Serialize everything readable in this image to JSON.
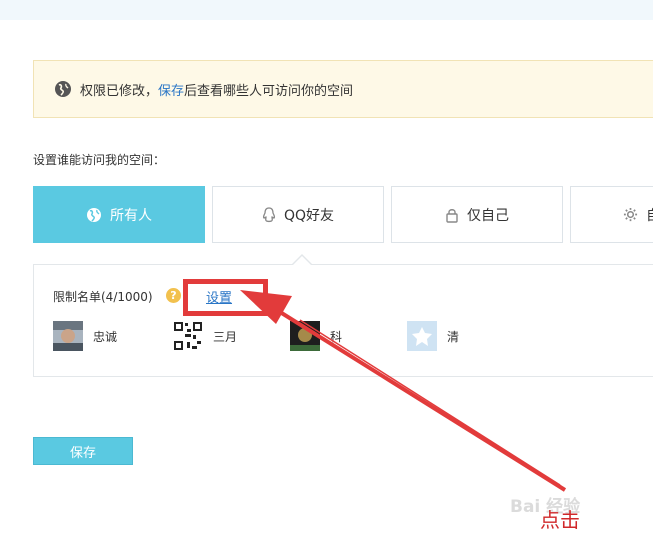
{
  "notice": {
    "prefix": "权限已修改，",
    "link": "保存",
    "suffix": "后查看哪些人可访问你的空间"
  },
  "section_title": "设置谁能访问我的空间：",
  "tabs": [
    {
      "label": "所有人",
      "icon": "globe-icon",
      "active": true
    },
    {
      "label": "QQ好友",
      "icon": "qq-penguin-icon",
      "active": false
    },
    {
      "label": "仅自己",
      "icon": "lock-icon",
      "active": false
    },
    {
      "label": "自",
      "icon": "gear-icon",
      "active": false
    }
  ],
  "restrict": {
    "label": "限制名单(4/1000)",
    "help": "?",
    "set_link": "设置"
  },
  "friends": [
    {
      "name": "忠诚"
    },
    {
      "name": "三月"
    },
    {
      "name": "科"
    },
    {
      "name": "清"
    }
  ],
  "save_button": "保存",
  "annotation": {
    "text": "点击"
  },
  "watermark": "Bai 经验",
  "colors": {
    "accent": "#5ac9e1",
    "link": "#2a76c6",
    "highlight": "#e23b3b",
    "notice_bg": "#fef9e7"
  }
}
